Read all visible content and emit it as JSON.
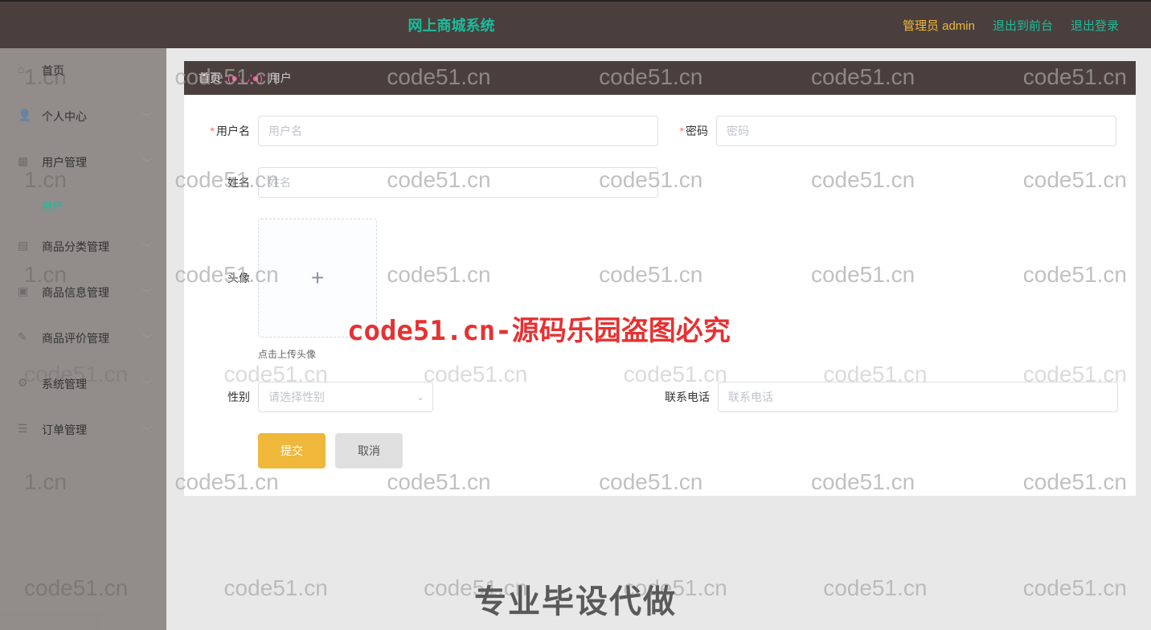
{
  "header": {
    "title": "网上商城系统",
    "admin_label": "管理员 admin",
    "logout_front": "退出到前台",
    "logout": "退出登录"
  },
  "sidebar": {
    "items": [
      {
        "label": "首页",
        "icon": "home-icon",
        "has_arrow": false
      },
      {
        "label": "个人中心",
        "icon": "user-icon",
        "has_arrow": true
      },
      {
        "label": "用户管理",
        "icon": "users-icon",
        "has_arrow": true
      },
      {
        "label": "商品分类管理",
        "icon": "category-icon",
        "has_arrow": true
      },
      {
        "label": "商品信息管理",
        "icon": "product-icon",
        "has_arrow": true
      },
      {
        "label": "商品评价管理",
        "icon": "review-icon",
        "has_arrow": true
      },
      {
        "label": "系统管理",
        "icon": "system-icon",
        "has_arrow": true
      },
      {
        "label": "订单管理",
        "icon": "order-icon",
        "has_arrow": true
      }
    ],
    "sub_user": "用户"
  },
  "breadcrumb": {
    "home": "首页",
    "emoji": "(●'◡'●)",
    "current": "用户"
  },
  "form": {
    "username_label": "用户名",
    "username_placeholder": "用户名",
    "password_label": "密码",
    "password_placeholder": "密码",
    "name_label": "姓名",
    "name_placeholder": "姓名",
    "avatar_label": "头像",
    "avatar_hint": "点击上传头像",
    "gender_label": "性别",
    "gender_placeholder": "请选择性别",
    "phone_label": "联系电话",
    "phone_placeholder": "联系电话",
    "submit": "提交",
    "cancel": "取消"
  },
  "watermark": {
    "text": "code51.cn",
    "partial": "1.cn",
    "red": "code51.cn-源码乐园盗图必究",
    "bottom": "专业毕设代做"
  }
}
